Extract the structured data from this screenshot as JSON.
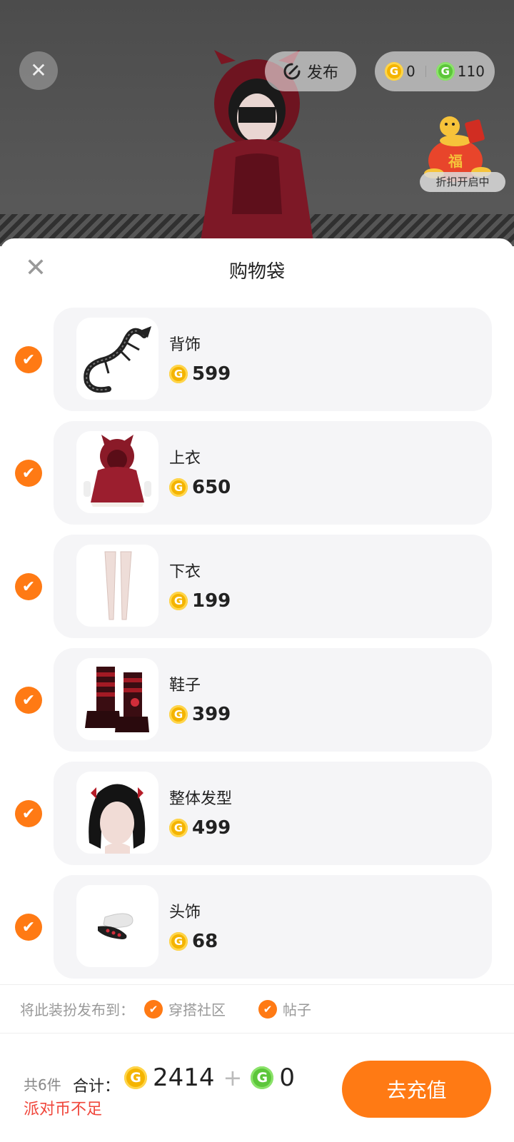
{
  "top_bar": {
    "close_icon": "close-icon",
    "publish_label": "发布",
    "gold_coin_amount": "0",
    "green_coin_amount": "110",
    "discount_label": "折扣开启中"
  },
  "sheet": {
    "title": "购物袋",
    "close_icon": "close-icon"
  },
  "items": [
    {
      "name": "背饰",
      "price": "599",
      "thumb": "dragon-back-accessory",
      "checked": true
    },
    {
      "name": "上衣",
      "price": "650",
      "thumb": "red-hood-top",
      "checked": true
    },
    {
      "name": "下衣",
      "price": "199",
      "thumb": "white-stockings",
      "checked": true
    },
    {
      "name": "鞋子",
      "price": "399",
      "thumb": "striped-boots",
      "checked": true
    },
    {
      "name": "整体发型",
      "price": "499",
      "thumb": "black-twin-hair",
      "checked": true
    },
    {
      "name": "头饰",
      "price": "68",
      "thumb": "hair-clip",
      "checked": true
    }
  ],
  "publish": {
    "label": "将此装扮发布到：",
    "options": [
      "穿搭社区",
      "帖子"
    ]
  },
  "footer": {
    "count_text": "共6件",
    "total_label": "合计：",
    "gold_total": "2414",
    "plus": "+",
    "green_total": "0",
    "warning": "派对币不足",
    "recharge_label": "去充值"
  },
  "colors": {
    "accent": "#ff7a14",
    "warning": "#f0453a",
    "gold": "#f4b400",
    "green": "#5cc63a"
  }
}
